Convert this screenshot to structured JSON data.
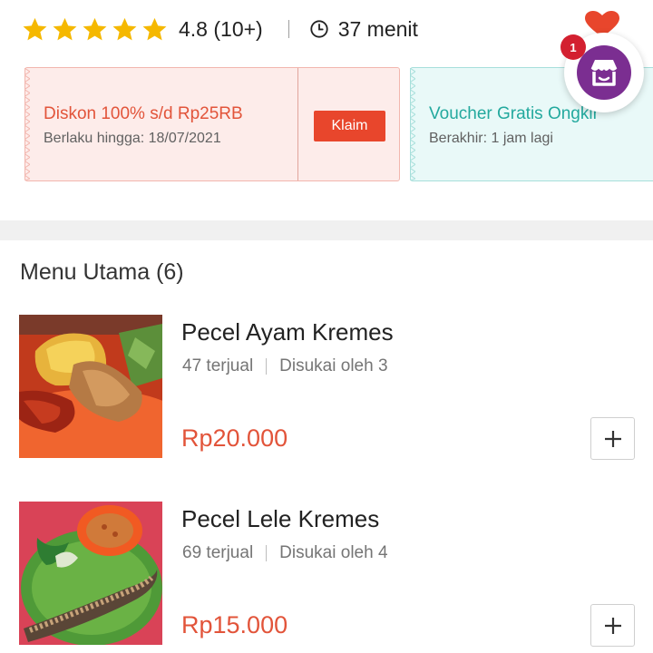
{
  "header": {
    "rating": "4.8 (10+)",
    "rating_stars": 5,
    "delivery_time": "37 menit"
  },
  "vouchers": [
    {
      "title": "Diskon 100% s/d Rp25RB",
      "subtitle": "Berlaku hingga: 18/07/2021",
      "button_label": "Klaim",
      "color": "#e2543a"
    },
    {
      "title": "Voucher Gratis Ongkir",
      "subtitle": "Berakhir: 1 jam lagi",
      "color": "#23a99e"
    }
  ],
  "store_badge": {
    "count": "1",
    "icon": "store-icon",
    "color": "#7b2e91"
  },
  "menu": {
    "title": "Menu Utama (6)",
    "items": [
      {
        "name": "Pecel Ayam Kremes",
        "sold": "47 terjual",
        "likes": "Disukai oleh 3",
        "price": "Rp20.000"
      },
      {
        "name": "Pecel Lele Kremes",
        "sold": "69 terjual",
        "likes": "Disukai oleh 4",
        "price": "Rp15.000"
      }
    ]
  },
  "colors": {
    "accent": "#e2543a",
    "star": "#f5b800",
    "teal": "#23a99e"
  }
}
